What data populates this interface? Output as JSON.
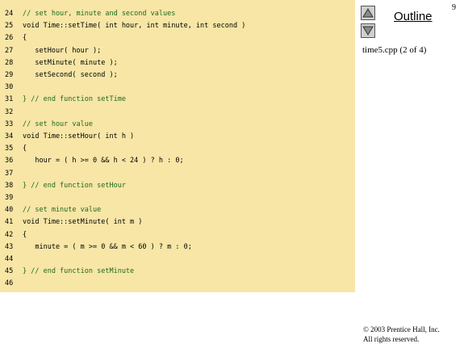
{
  "code": {
    "lines": [
      {
        "n": "24",
        "text": "// set hour, minute and second values"
      },
      {
        "n": "25",
        "text": "void Time::setTime( int hour, int minute, int second )"
      },
      {
        "n": "26",
        "text": "{"
      },
      {
        "n": "27",
        "text": "   setHour( hour );"
      },
      {
        "n": "28",
        "text": "   setMinute( minute );"
      },
      {
        "n": "29",
        "text": "   setSecond( second );"
      },
      {
        "n": "30",
        "text": ""
      },
      {
        "n": "31",
        "text": "} // end function setTime"
      },
      {
        "n": "32",
        "text": ""
      },
      {
        "n": "33",
        "text": "// set hour value"
      },
      {
        "n": "34",
        "text": "void Time::setHour( int h )"
      },
      {
        "n": "35",
        "text": "{"
      },
      {
        "n": "36",
        "text": "   hour = ( h >= 0 && h < 24 ) ? h : 0;"
      },
      {
        "n": "37",
        "text": ""
      },
      {
        "n": "38",
        "text": "} // end function setHour"
      },
      {
        "n": "39",
        "text": ""
      },
      {
        "n": "40",
        "text": "// set minute value"
      },
      {
        "n": "41",
        "text": "void Time::setMinute( int m )"
      },
      {
        "n": "42",
        "text": "{"
      },
      {
        "n": "43",
        "text": "   minute = ( m >= 0 && m < 60 ) ? m : 0;"
      },
      {
        "n": "44",
        "text": ""
      },
      {
        "n": "45",
        "text": "} // end function setMinute"
      },
      {
        "n": "46",
        "text": ""
      }
    ]
  },
  "sidebar": {
    "page_number": "9",
    "outline_title": "Outline",
    "file_label": "time5.cpp (2 of 4)",
    "up_icon": "triangle-up-icon",
    "down_icon": "triangle-down-icon"
  },
  "footer": {
    "copyright_line1": "© 2003 Prentice Hall, Inc.",
    "copyright_line2": "All rights reserved."
  },
  "colors": {
    "panel_bg": "#f7e6a6",
    "comment": "#1f6a1f",
    "keyword": "#001a80"
  }
}
